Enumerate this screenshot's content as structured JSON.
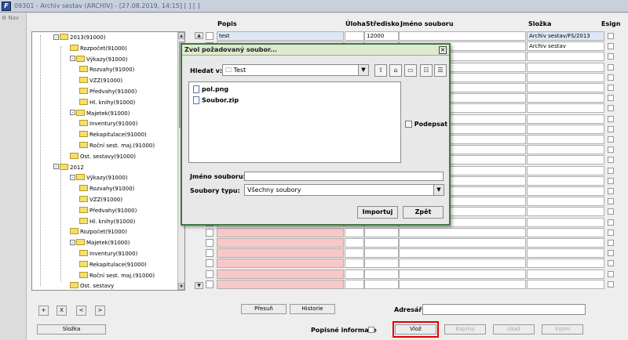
{
  "window": {
    "title": "09301 - Archiv sestav (ARCHIV) - [27.08.2019, 14:15]  [  ]  [  ]",
    "nav_label": "Nav"
  },
  "tree": [
    {
      "label": "2013(91000)",
      "level": 1,
      "exp": "-"
    },
    {
      "label": "Rozpočet(91000)",
      "level": 2
    },
    {
      "label": "Výkazy(91000)",
      "level": 2,
      "exp": "-"
    },
    {
      "label": "Rozvahy(91000)",
      "level": 3
    },
    {
      "label": "VZZ(91000)",
      "level": 3
    },
    {
      "label": "Předvahy(91000)",
      "level": 3
    },
    {
      "label": "Hl. knihy(91000)",
      "level": 3
    },
    {
      "label": "Majetek(91000)",
      "level": 2,
      "exp": "-"
    },
    {
      "label": "Inventury(91000)",
      "level": 3
    },
    {
      "label": "Rekapitulace(91000)",
      "level": 3
    },
    {
      "label": "Roční sest. maj.(91000)",
      "level": 3
    },
    {
      "label": "Ost. sestavy(91000)",
      "level": 2
    },
    {
      "label": "2012",
      "level": 1,
      "exp": "-"
    },
    {
      "label": "Výkazy(91000)",
      "level": 2,
      "exp": "-"
    },
    {
      "label": "Rozvahy(91000)",
      "level": 3
    },
    {
      "label": "VZZ(91000)",
      "level": 3
    },
    {
      "label": "Předvahy(91000)",
      "level": 3
    },
    {
      "label": "Hl. knihy(91000)",
      "level": 3
    },
    {
      "label": "Rozpočet(91000)",
      "level": 2
    },
    {
      "label": "Majetek(91000)",
      "level": 2,
      "exp": "-"
    },
    {
      "label": "Inventury(91000)",
      "level": 3
    },
    {
      "label": "Rekapitulace(91000)",
      "level": 3
    },
    {
      "label": "Roční sest. maj.(91000)",
      "level": 3
    },
    {
      "label": "Ost. sestavy",
      "level": 2
    }
  ],
  "grid": {
    "headers": {
      "popis": "Popis",
      "uloha": "Úloha",
      "stredisko": "Středisko",
      "jmeno": "Jméno souboru",
      "slozka": "Složka",
      "esign": "Esign"
    },
    "rows": [
      {
        "popis": "test",
        "uloha": "",
        "stredisko": "12000",
        "jmeno": "",
        "slozka": "Archiv sestav/FS/2013"
      },
      {
        "popis": "",
        "uloha": "",
        "stredisko": "",
        "jmeno": "",
        "slozka": "Archiv sestav"
      }
    ]
  },
  "dialog": {
    "title": "Zvol požadovaný soubor...",
    "look_in_label": "Hledat v:",
    "look_in_value": "Test",
    "files": [
      "pol.png",
      "Soubor.zip"
    ],
    "sign_label": "Podepsat",
    "filename_label": "Jméno souboru:",
    "filetype_label": "Soubory typu:",
    "filetype_value": "Všechny soubory",
    "import_button": "Importuj",
    "back_button": "Zpět"
  },
  "bottom": {
    "nav_buttons": [
      "+",
      "X",
      "<",
      ">"
    ],
    "presun": "Přesuň",
    "historie": "Historie",
    "adresar_label": "Adresář:",
    "slozka": "Složka",
    "popisne_label": "Popisné informace",
    "vloz": "Vlož",
    "kopiruj": "Kopíruj",
    "ukaz": "Ukaž",
    "vyjmi": "Vyjmi"
  }
}
